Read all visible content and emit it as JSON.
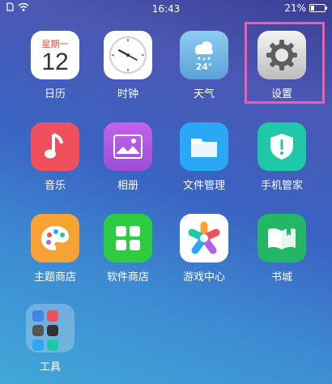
{
  "status": {
    "time": "16:43",
    "battery": "21%",
    "battery_level": 0.21
  },
  "apps": [
    {
      "label": "日历",
      "weekday": "星期一",
      "day": "12"
    },
    {
      "label": "时钟"
    },
    {
      "label": "天气",
      "temperature": "24°"
    },
    {
      "label": "设置"
    },
    {
      "label": "音乐"
    },
    {
      "label": "相册"
    },
    {
      "label": "文件管理"
    },
    {
      "label": "手机管家"
    },
    {
      "label": "主题商店"
    },
    {
      "label": "软件商店"
    },
    {
      "label": "游戏中心"
    },
    {
      "label": "书城"
    },
    {
      "label": "工具"
    }
  ],
  "colors": {
    "highlight": "#ef5ea7",
    "music": "#f0505c",
    "gallery": "#b85ee0",
    "files": "#2aa7f5",
    "security": "#1fc8a6",
    "themes": "#f7a234",
    "appstore": "#2ecc40",
    "books": "#23b765"
  }
}
